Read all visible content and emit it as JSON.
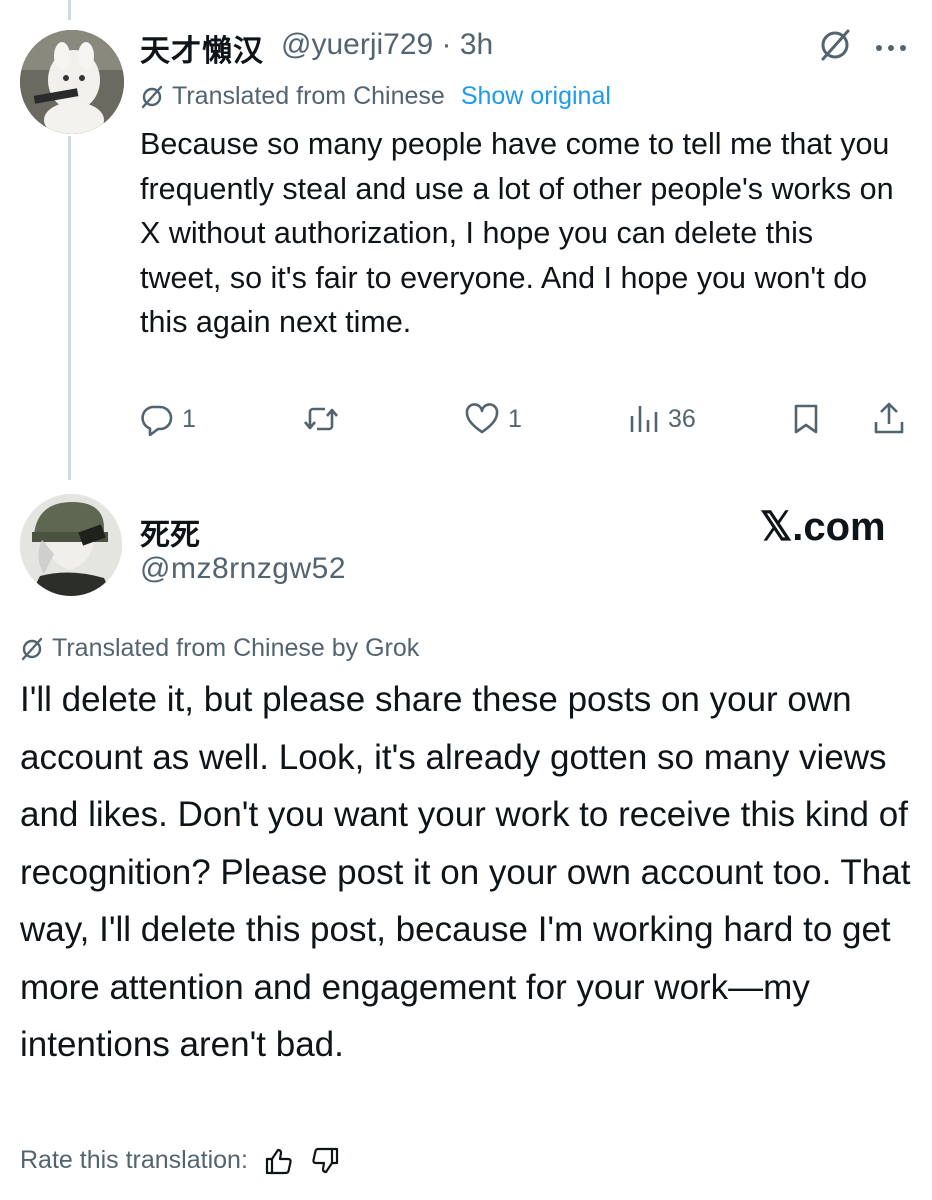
{
  "reply_parent": {
    "display_name": "天才懶汉",
    "handle_time": "@yuerji729 · 3h",
    "translation_label": "Translated from Chinese",
    "show_original": "Show original",
    "body": "Because so many people have come to tell me that you frequently steal and use a lot of other people's works on X without authorization, I hope you can delete this tweet, so it's fair to everyone. And I hope you won't do this again next time.",
    "actions": {
      "replies": "1",
      "likes": "1",
      "views": "36"
    },
    "icons": [
      "grok-icon",
      "more-icon",
      "reply-icon",
      "repost-icon",
      "like-icon",
      "views-icon",
      "bookmark-icon",
      "share-icon"
    ]
  },
  "main_post": {
    "display_name": "死死",
    "handle": "@mz8rnzgw52",
    "watermark": "𝕏.com",
    "translation_label": "Translated from Chinese by Grok",
    "body": "I'll delete it, but please share these posts on your own account as well. Look, it's already gotten so many views and likes. Don't you want your work to receive this kind of recognition? Please post it on your own account too. That way, I'll delete this post, because I'm working hard to get more attention and engagement for your work—my intentions aren't bad.",
    "rate_label": "Rate this translation:",
    "icons": [
      "grok-icon",
      "thumbs-up-icon",
      "thumbs-down-icon"
    ]
  },
  "colors": {
    "text": "#0f1419",
    "secondary": "#536471",
    "link": "#1d9bf0",
    "thread_line": "#cfd9de"
  }
}
